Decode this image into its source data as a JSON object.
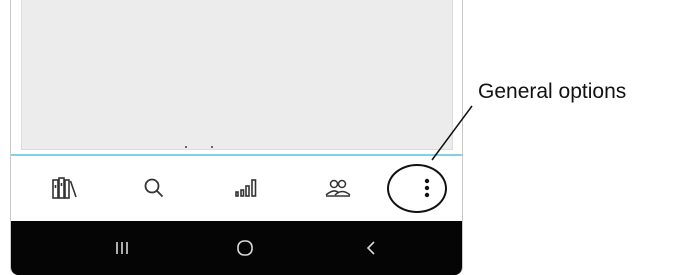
{
  "bottom_nav": {
    "items": [
      {
        "name": "library",
        "icon": "library-books-icon"
      },
      {
        "name": "search",
        "icon": "search-icon"
      },
      {
        "name": "statistics",
        "icon": "signal-bars-icon"
      },
      {
        "name": "people",
        "icon": "people-icon"
      },
      {
        "name": "general-options",
        "icon": "more-vertical-icon"
      }
    ]
  },
  "system_nav": {
    "items": [
      {
        "name": "recent-apps",
        "icon": "recent-apps-icon"
      },
      {
        "name": "home",
        "icon": "home-icon"
      },
      {
        "name": "back",
        "icon": "back-icon"
      }
    ]
  },
  "callout": {
    "label": "General options"
  },
  "colors": {
    "accent_line": "#7fd3e3",
    "system_bar": "#050505",
    "content_bg": "#ececec",
    "icon": "#333333"
  }
}
